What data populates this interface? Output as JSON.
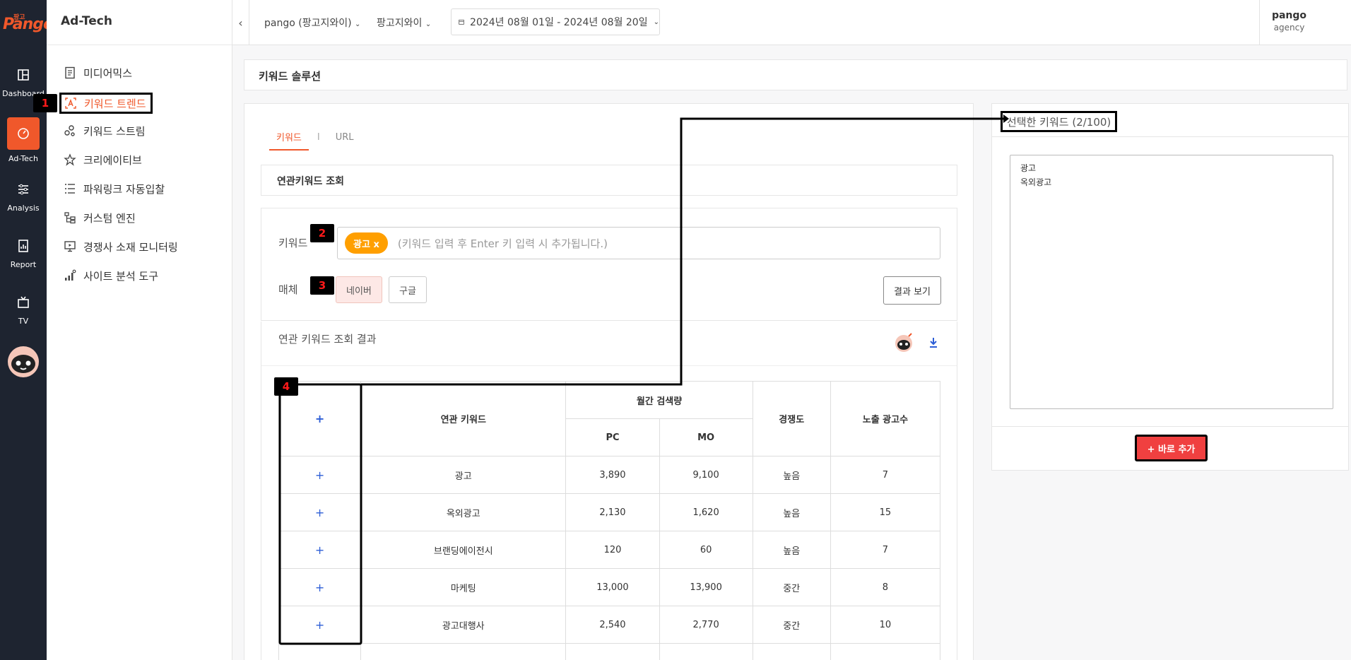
{
  "brand": {
    "logo_text": "Pango",
    "logo_sub": "팡고"
  },
  "rail": {
    "items": [
      {
        "label": "Dashboard",
        "icon": "dashboard-icon"
      },
      {
        "label": "Ad-Tech",
        "icon": "gauge-icon"
      },
      {
        "label": "Analysis",
        "icon": "sliders-icon"
      },
      {
        "label": "Report",
        "icon": "report-icon"
      },
      {
        "label": "TV",
        "icon": "tv-icon"
      }
    ]
  },
  "menu": {
    "title": "Ad-Tech",
    "items": [
      {
        "label": "미디어믹스",
        "icon": "document-icon"
      },
      {
        "label": "키워드 트렌드",
        "icon": "keyword-trend-icon",
        "active": true
      },
      {
        "label": "키워드 스트림",
        "icon": "stream-icon"
      },
      {
        "label": "크리에이티브",
        "icon": "creative-icon"
      },
      {
        "label": "파워링크 자동입찰",
        "icon": "list-icon"
      },
      {
        "label": "커스텀 엔진",
        "icon": "tree-icon"
      },
      {
        "label": "경쟁사 소재 모니터링",
        "icon": "monitor-icon"
      },
      {
        "label": "사이트 분석 도구",
        "icon": "analytics-icon"
      }
    ]
  },
  "topbar": {
    "back_icon": "chevron-left-icon",
    "account_dropdown": "pango (팡고지와이)",
    "brand_dropdown": "팡고지와이",
    "date_range": "2024년 08월 01일 - 2024년 08월 20일",
    "user_name": "pango",
    "user_role": "agency"
  },
  "page": {
    "title": "키워드 솔루션",
    "tabs": [
      "키워드",
      "URL"
    ],
    "tab_separator": "I",
    "query_section_title": "연관키워드 조회",
    "keyword_label": "키워드",
    "keyword_chip": "광고 x",
    "keyword_placeholder": "(키워드 입력 후 Enter 키 입력 시 추가됩니다.)",
    "media_label": "매체",
    "media_options": [
      "네이버",
      "구글"
    ],
    "result_button": "결과 보기",
    "results_title": "연관 키워드 조회 결과",
    "table": {
      "add_all": "+",
      "col_keyword": "연관 키워드",
      "col_monthly": "월간 검색량",
      "col_pc": "PC",
      "col_mo": "MO",
      "col_competition": "경쟁도",
      "col_ads": "노출 광고수",
      "rows": [
        {
          "add": "+",
          "keyword": "광고",
          "pc": "3,890",
          "mo": "9,100",
          "competition": "높음",
          "ads": "7"
        },
        {
          "add": "+",
          "keyword": "옥외광고",
          "pc": "2,130",
          "mo": "1,620",
          "competition": "높음",
          "ads": "15"
        },
        {
          "add": "+",
          "keyword": "브랜딩에이전시",
          "pc": "120",
          "mo": "60",
          "competition": "높음",
          "ads": "7"
        },
        {
          "add": "+",
          "keyword": "마케팅",
          "pc": "13,000",
          "mo": "13,900",
          "competition": "중간",
          "ads": "8"
        },
        {
          "add": "+",
          "keyword": "광고대행사",
          "pc": "2,540",
          "mo": "2,770",
          "competition": "중간",
          "ads": "10"
        }
      ]
    }
  },
  "side": {
    "title": "선택한 키워드 (2/100)",
    "selected_text": "광고\n옥외광고",
    "add_button": "+ 바로 추가"
  },
  "annotations": [
    "1",
    "2",
    "3",
    "4"
  ],
  "colors": {
    "accent": "#f0582b",
    "rail_bg": "#1e2430",
    "chip": "#ff9f00",
    "add_button": "#f04040",
    "annotation_red": "#ff1a1a"
  }
}
